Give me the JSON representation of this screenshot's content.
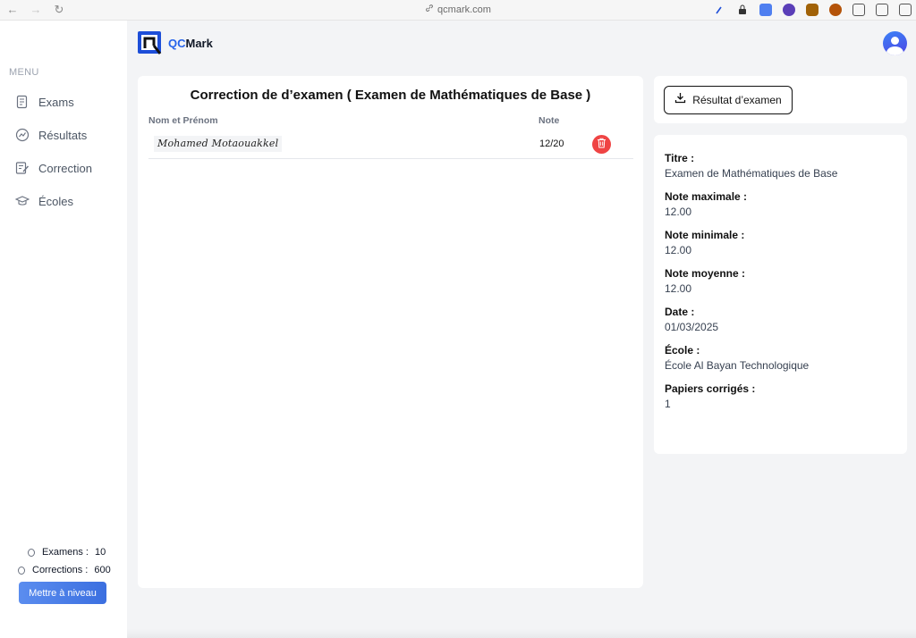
{
  "browser": {
    "url": "qcmark.com"
  },
  "header": {
    "brand_qc": "QC",
    "brand_mark": "Mark"
  },
  "sidebar": {
    "menu_title": "MENU",
    "items": [
      {
        "label": "Exams",
        "icon": "exam-document-icon"
      },
      {
        "label": "Résultats",
        "icon": "chart-circle-icon"
      },
      {
        "label": "Correction",
        "icon": "edit-document-icon"
      },
      {
        "label": "Écoles",
        "icon": "graduation-cap-icon"
      }
    ],
    "stats": {
      "exams_label": "Examens :",
      "exams_value": "10",
      "corrections_label": "Corrections :",
      "corrections_value": "600"
    },
    "upgrade_label": "Mettre à niveau"
  },
  "main": {
    "title": "Correction de d’examen ( Examen de Mathématiques de Base )",
    "columns": [
      "Nom et Prénom",
      "Note"
    ],
    "rows": [
      {
        "name": "Mohamed Motaouakkel",
        "grade": "12/20"
      }
    ]
  },
  "download": {
    "label": "Résultat d’examen"
  },
  "details": {
    "fields": [
      {
        "label": "Titre :",
        "value": "Examen de Mathématiques de Base"
      },
      {
        "label": "Note maximale :",
        "value": "12.00"
      },
      {
        "label": "Note minimale :",
        "value": "12.00"
      },
      {
        "label": "Note moyenne :",
        "value": "12.00"
      },
      {
        "label": "Date :",
        "value": "01/03/2025"
      },
      {
        "label": "École :",
        "value": "École Al Bayan Technologique"
      },
      {
        "label": "Papiers corrigés :",
        "value": "1"
      }
    ]
  },
  "colors": {
    "accent": "#2563eb",
    "danger": "#ef4444",
    "upgrade": "#4a7ee8"
  }
}
